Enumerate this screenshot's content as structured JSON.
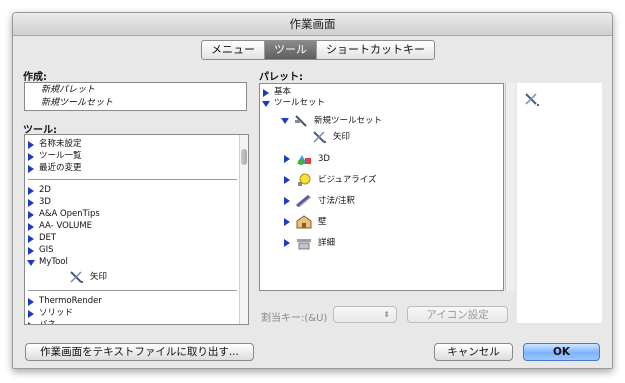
{
  "window": {
    "title": "作業画面"
  },
  "tabs": [
    {
      "label": "メニュー"
    },
    {
      "label": "ツール"
    },
    {
      "label": "ショートカットキー"
    }
  ],
  "create": {
    "label": "作成:",
    "items": [
      "新規パレット",
      "新規ツールセット"
    ]
  },
  "tools": {
    "label": "ツール:",
    "group1": [
      "名称未設定",
      "ツール一覧",
      "最近の変更"
    ],
    "group2": [
      "2D",
      "3D",
      "A&A OpenTips",
      "AA- VOLUME",
      "DET",
      "GIS",
      "MyTool"
    ],
    "mytool_child": "矢印",
    "group3": [
      "ThermoRender",
      "ソリッド",
      "バネ"
    ]
  },
  "palette": {
    "label": "パレット:",
    "kihon": "基本",
    "toolset": "ツールセット",
    "new_toolset": "新規ツールセット",
    "arrow": "矢印",
    "children": [
      "3D",
      "ビジュアライズ",
      "寸法/注釈",
      "壁",
      "詳細"
    ]
  },
  "shortcut": {
    "label": "割当キー:(&U)",
    "icon_settings_label": "アイコン設定"
  },
  "buttons": {
    "export_label": "作業画面をテキストファイルに取り出す...",
    "cancel_label": "キャンセル",
    "ok_label": "OK"
  },
  "colors": {
    "disclosure": "#1a3cc0",
    "ok_button": "#7fb3ff"
  }
}
